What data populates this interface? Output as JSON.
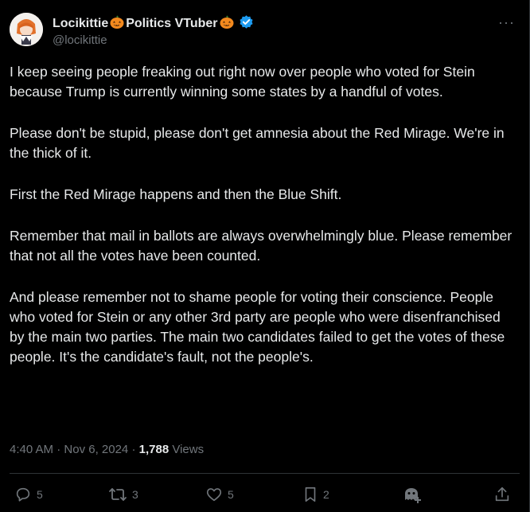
{
  "author": {
    "name_part1": "Locikittie",
    "name_part2": "Politics VTuber",
    "handle": "@locikittie",
    "verified_color": "#1d9bf0"
  },
  "menu": {
    "more_label": "···"
  },
  "post": {
    "paragraphs": [
      "I keep seeing people freaking out right now over people who voted for Stein because Trump is currently winning some states by a handful of votes.",
      "Please don't be stupid, please don't get amnesia about the Red Mirage. We're in the thick of it.",
      "First the Red Mirage happens and then the Blue Shift.",
      "Remember that mail in ballots are always overwhelmingly blue. Please remember that not all the votes have been counted.",
      "And please remember not to shame people for voting their conscience. People who voted for Stein or any other 3rd party are people who were disenfranchised by the main two parties. The main two candidates failed to get the votes of these people. It's the candidate's fault, not the people's."
    ],
    "time": "4:40 AM",
    "sep": "·",
    "date": "Nov 6, 2024",
    "views_count": "1,788",
    "views_label": "Views"
  },
  "actions": {
    "replies": "5",
    "reposts": "3",
    "likes": "5",
    "bookmarks": "2"
  },
  "colors": {
    "background": "#000000",
    "text": "#e7e9ea",
    "muted": "#71767b",
    "accent": "#1d9bf0"
  }
}
